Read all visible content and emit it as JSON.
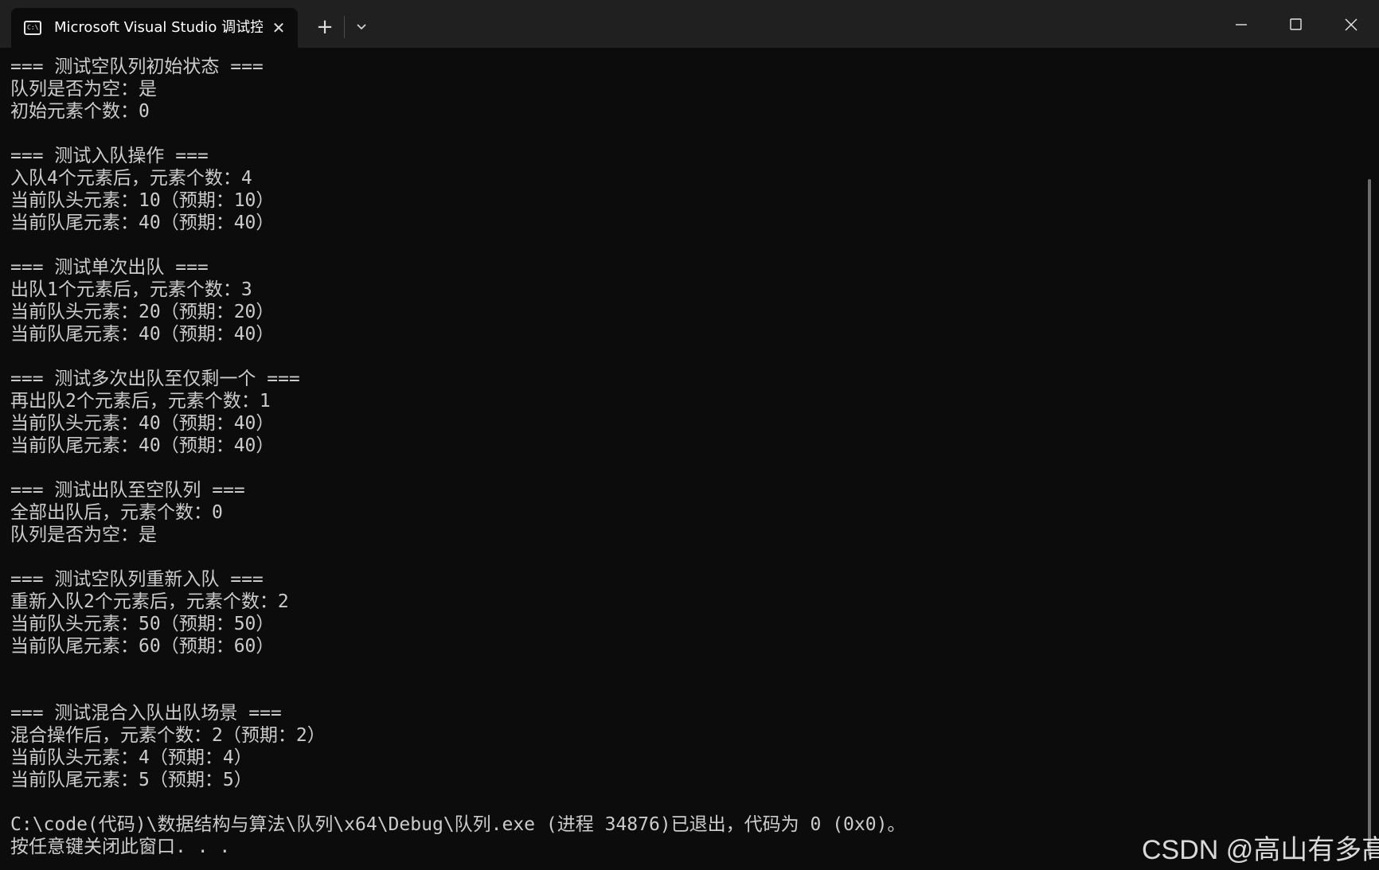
{
  "window": {
    "tab_title": "Microsoft Visual Studio 调试控",
    "tab_icon": "console-icon",
    "tab_icon_text": "C:\\",
    "close_tab_glyph": "✕",
    "new_tab_glyph": "+",
    "dropdown_icon": "chevron-down-icon",
    "minimize_icon": "minimize-icon",
    "maximize_icon": "maximize-icon",
    "close_icon": "close-icon"
  },
  "console": {
    "lines": [
      "=== 测试空队列初始状态 ===",
      "队列是否为空：是",
      "初始元素个数：0",
      "",
      "=== 测试入队操作 ===",
      "入队4个元素后，元素个数：4",
      "当前队头元素：10（预期：10）",
      "当前队尾元素：40（预期：40）",
      "",
      "=== 测试单次出队 ===",
      "出队1个元素后，元素个数：3",
      "当前队头元素：20（预期：20）",
      "当前队尾元素：40（预期：40）",
      "",
      "=== 测试多次出队至仅剩一个 ===",
      "再出队2个元素后，元素个数：1",
      "当前队头元素：40（预期：40）",
      "当前队尾元素：40（预期：40）",
      "",
      "=== 测试出队至空队列 ===",
      "全部出队后，元素个数：0",
      "队列是否为空：是",
      "",
      "=== 测试空队列重新入队 ===",
      "重新入队2个元素后，元素个数：2",
      "当前队头元素：50（预期：50）",
      "当前队尾元素：60（预期：60）",
      "",
      "",
      "=== 测试混合入队出队场景 ===",
      "混合操作后，元素个数：2（预期：2）",
      "当前队头元素：4（预期：4）",
      "当前队尾元素：5（预期：5）",
      "",
      "C:\\code(代码)\\数据结构与算法\\队列\\x64\\Debug\\队列.exe (进程 34876)已退出，代码为 0 (0x0)。",
      "按任意键关闭此窗口. . ."
    ]
  },
  "watermark": "CSDN @高山有多高",
  "colors": {
    "background": "#0c0c0c",
    "titlebar": "#202020",
    "text": "#cccccc"
  }
}
